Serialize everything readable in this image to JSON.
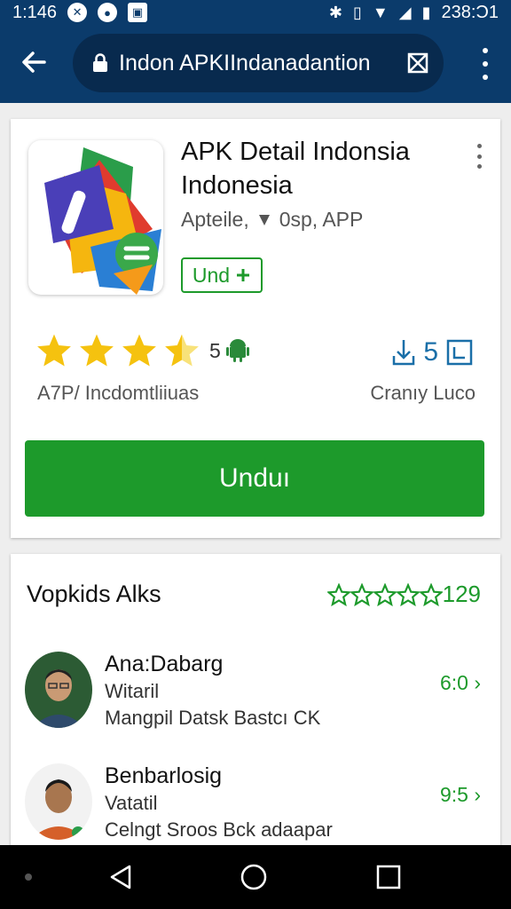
{
  "status_bar": {
    "time": "1:146",
    "clock": "238:Ͻ1",
    "notif_icons": [
      "x-icon",
      "record-icon",
      "image-icon"
    ]
  },
  "browser": {
    "url": "Indon APKIIndanadantion"
  },
  "app": {
    "title": "APK Detail Indonsia Indonesia",
    "category": "Apteile,",
    "size_info": "0sp, APP",
    "chip_label": "Und",
    "rating_value": "5",
    "rating_stars": 3.5,
    "rating_sub": "A7P/ Incdomtliiuas",
    "downloads": "5",
    "downloads_sub": "Cranıy Luco",
    "install_label": "Unduı"
  },
  "reviews": {
    "title": "Vopkids Alks",
    "score": "129",
    "items": [
      {
        "name": "Ana:Dabarg",
        "role": "Witaril",
        "text": "Mangpil Datsk Bastcı CK",
        "score": "6:0",
        "shirt": "#2e4a6b",
        "bg": "#2c5b34"
      },
      {
        "name": "Benbarlosig",
        "role": "Vatatil",
        "text": "Celngt Sroos Bck adaapar",
        "score": "9:5",
        "shirt": "#d5602a",
        "bg": "#f2f2f2"
      }
    ]
  },
  "colors": {
    "primary": "#0b3b6b",
    "accent_green": "#1d9a2b",
    "star_yellow": "#f5c20f"
  }
}
